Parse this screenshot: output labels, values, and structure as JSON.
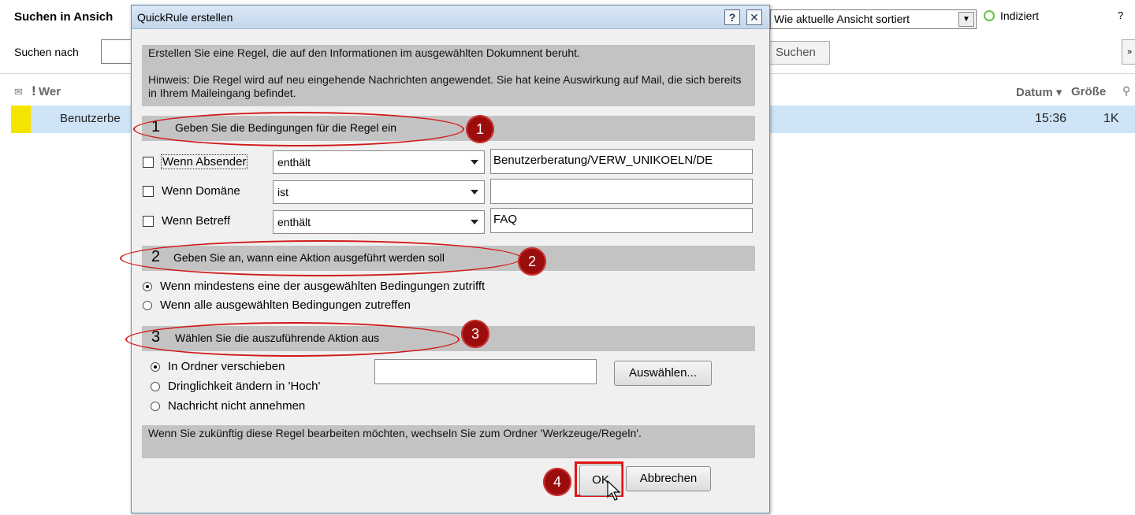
{
  "background": {
    "title": "Suchen in Ansich",
    "sort_value": "Wie aktuelle Ansicht sortiert",
    "indexed_label": "Indiziert",
    "help_label": "?",
    "search_label": "Suchen nach",
    "search_button": "Suchen",
    "expand_label": "»",
    "columns": {
      "bang": "!",
      "who": "Wer",
      "date": "Datum ▾",
      "size": "Größe",
      "clip": "⚲"
    },
    "mail": {
      "sender": "Benutzerbe",
      "time": "15:36",
      "size": "1K"
    }
  },
  "dialog": {
    "title": "QuickRule erstellen",
    "help_button": "?",
    "close_button": "✕",
    "intro_line1": "Erstellen Sie eine Regel, die auf den Informationen im ausgewählten Dokumnent beruht.",
    "intro_line2": "Hinweis: Die Regel wird auf neu eingehende Nachrichten angewendet. Sie hat keine Auswirkung auf Mail, die sich bereits in Ihrem Maileingang befindet.",
    "sections": [
      {
        "num": "1",
        "label": "Geben Sie die Bedingungen für die Regel ein",
        "badge": "1"
      },
      {
        "num": "2",
        "label": "Geben Sie an, wann eine Aktion ausgeführt werden soll",
        "badge": "2"
      },
      {
        "num": "3",
        "label": "Wählen Sie die auszuführende Aktion aus",
        "badge": "3"
      }
    ],
    "conditions": [
      {
        "label": "Wenn Absender",
        "operator": "enthält",
        "value": "Benutzerberatung/VERW_UNIKOELN/DE",
        "checked": false
      },
      {
        "label": "Wenn Domäne",
        "operator": "ist",
        "value": "",
        "checked": false
      },
      {
        "label": "Wenn Betreff",
        "operator": "enthält",
        "value": "FAQ",
        "checked": false
      }
    ],
    "when_options": [
      {
        "label": "Wenn mindestens eine der ausgewählten Bedingungen zutrifft",
        "selected": true
      },
      {
        "label": "Wenn alle ausgewählten Bedingungen zutreffen",
        "selected": false
      }
    ],
    "action_options": [
      {
        "label": "In Ordner verschieben",
        "selected": true
      },
      {
        "label": "Dringlichkeit ändern in 'Hoch'",
        "selected": false
      },
      {
        "label": "Nachricht nicht annehmen",
        "selected": false
      }
    ],
    "choose_button": "Auswählen...",
    "footer_note": "Wenn Sie zukünftig diese Regel bearbeiten möchten, wechseln Sie zum Ordner 'Werkzeuge/Regeln'.",
    "ok_button": "OK",
    "cancel_button": "Abbrechen",
    "ok_badge": "4"
  },
  "colors": {
    "annotation_red": "#d21a1a",
    "badge_red": "#9b0d0d",
    "selected_row": "#cfe5f7",
    "flag_yellow": "#f5e400"
  }
}
